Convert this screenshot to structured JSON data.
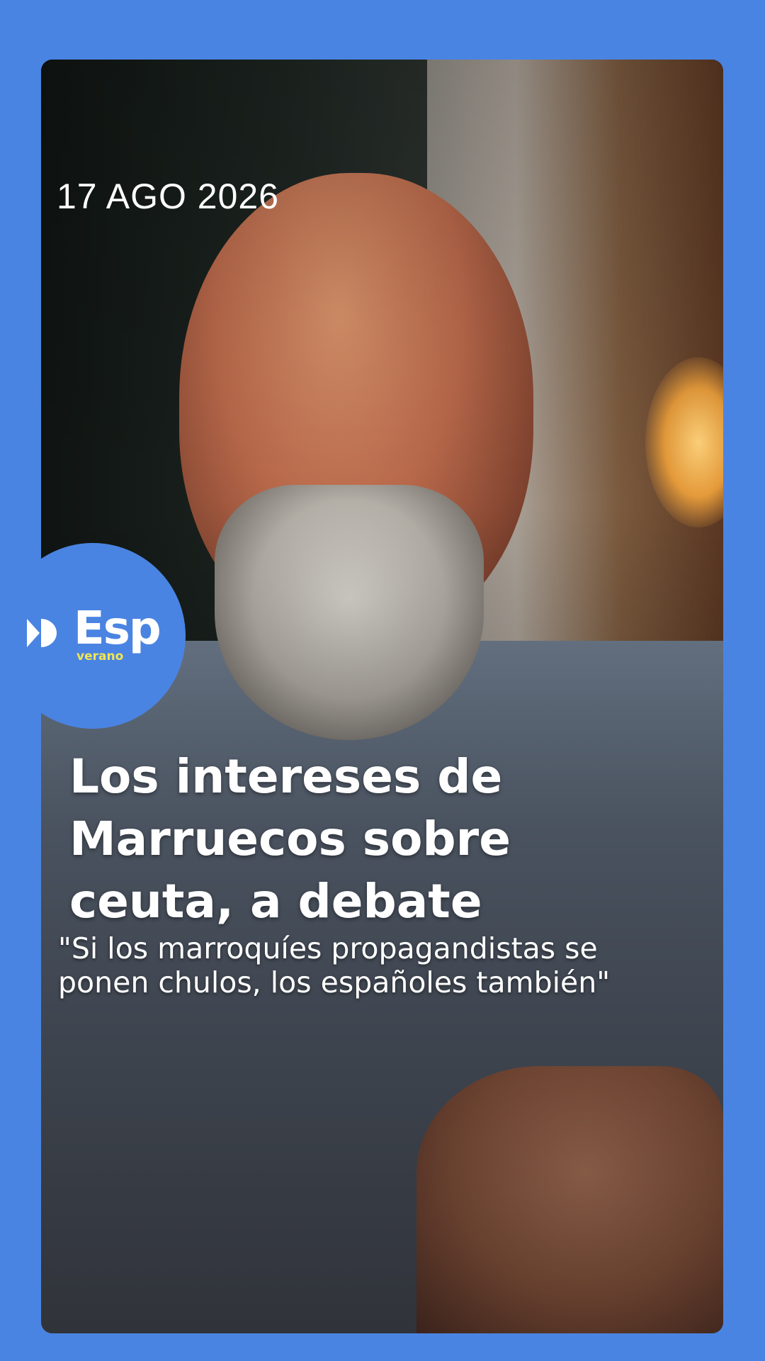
{
  "post": {
    "date": "17 AGO 2026",
    "headline_lines": [
      "Los intereses de",
      "Marruecos sobre",
      "ceuta, a debate"
    ],
    "quote": "\"Si los marroquíes propagandistas se ponen chulos, los españoles también\""
  },
  "brand": {
    "name": "Esp",
    "subtitle": "verano",
    "icon": "fast-forward-icon",
    "colors": {
      "background": "#4a84e2",
      "logo_text": "#ffffff",
      "logo_subtitle": "#f2e650"
    }
  }
}
